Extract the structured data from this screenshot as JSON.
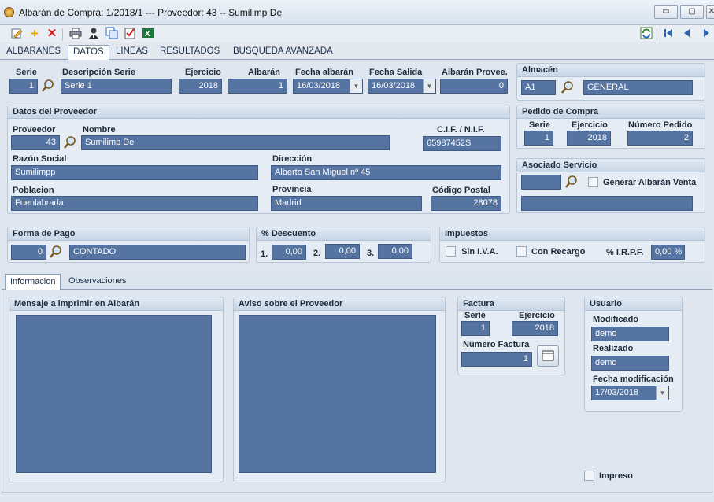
{
  "window": {
    "title": "Albarán de Compra: 1/2018/1  ---  Proveedor: 43  --  Sumilimp De",
    "minimize": "▭",
    "maximize": "▢",
    "close": "✕"
  },
  "toolbar": {
    "icons": [
      "edit-icon",
      "add-icon",
      "delete-icon",
      "print-icon",
      "user-icon",
      "copy-icon",
      "checklist-icon",
      "excel-icon",
      "refresh-icon",
      "first-icon",
      "prev-icon",
      "next-icon"
    ]
  },
  "tabs": [
    "ALBARANES",
    "DATOS",
    "LINEAS",
    "RESULTADOS",
    "BUSQUEDA AVANZADA"
  ],
  "header": {
    "serie_label": "Serie",
    "serie": "1",
    "desc_serie_label": "Descripción Serie",
    "desc_serie": "Serie 1",
    "ejercicio_label": "Ejercicio",
    "ejercicio": "2018",
    "albaran_label": "Albarán",
    "albaran": "1",
    "fecha_albaran_label": "Fecha albarán",
    "fecha_albaran": "16/03/2018",
    "fecha_salida_label": "Fecha Salida",
    "fecha_salida": "16/03/2018",
    "albaran_prov_label": "Albarán Provee.",
    "albaran_prov": "0"
  },
  "almacen": {
    "title": "Almacén",
    "code": "A1",
    "name": "GENERAL"
  },
  "proveedor": {
    "title": "Datos del Proveedor",
    "proveedor_label": "Proveedor",
    "proveedor": "43",
    "nombre_label": "Nombre",
    "nombre": "Sumilimp De",
    "cif_label": "C.I.F. / N.I.F.",
    "cif": "65987452S",
    "razon_label": "Razón Social",
    "razon": "Sumilimpp",
    "direccion_label": "Dirección",
    "direccion": "Alberto San Miguel nº 45",
    "poblacion_label": "Poblacion",
    "poblacion": "Fuenlabrada",
    "provincia_label": "Provincia",
    "provincia": "Madrid",
    "cp_label": "Código Postal",
    "cp": "28078"
  },
  "pedido": {
    "title": "Pedido de Compra",
    "serie_label": "Serie",
    "serie": "1",
    "ejercicio_label": "Ejercicio",
    "ejercicio": "2018",
    "numero_label": "Número Pedido",
    "numero": "2"
  },
  "asociado": {
    "title": "Asociado Servicio",
    "generar_label": "Generar Albarán  Venta"
  },
  "pago": {
    "title": "Forma de Pago",
    "code": "0",
    "name": "CONTADO"
  },
  "descuento": {
    "title": "% Descuento",
    "d1_label": "1.",
    "d1": "0,00",
    "d2_label": "2.",
    "d2": "0,00",
    "d3_label": "3.",
    "d3": "0,00"
  },
  "impuestos": {
    "title": "Impuestos",
    "siniva_label": "Sin I.V.A.",
    "recargo_label": "Con Recargo",
    "irpf_label": "% I.R.P.F.",
    "irpf": "0,00 %"
  },
  "subtabs": [
    "Informacion",
    "Observaciones"
  ],
  "mensaje": {
    "title": "Mensaje a imprimir en Albarán"
  },
  "aviso": {
    "title": "Aviso sobre el Proveedor"
  },
  "factura": {
    "title": "Factura",
    "serie_label": "Serie",
    "serie": "1",
    "ejercicio_label": "Ejercicio",
    "ejercicio": "2018",
    "numero_label": "Número Factura",
    "numero": "1"
  },
  "usuario": {
    "title": "Usuario",
    "modificado_label": "Modificado",
    "modificado": "demo",
    "realizado_label": "Realizado",
    "realizado": "demo",
    "fecha_mod_label": "Fecha modificación",
    "fecha_mod": "17/03/2018"
  },
  "impreso_label": "Impreso",
  "colors": {
    "field": "#5674a2",
    "panel_header": "#c9d6e6",
    "background": "#dfe6ef"
  }
}
